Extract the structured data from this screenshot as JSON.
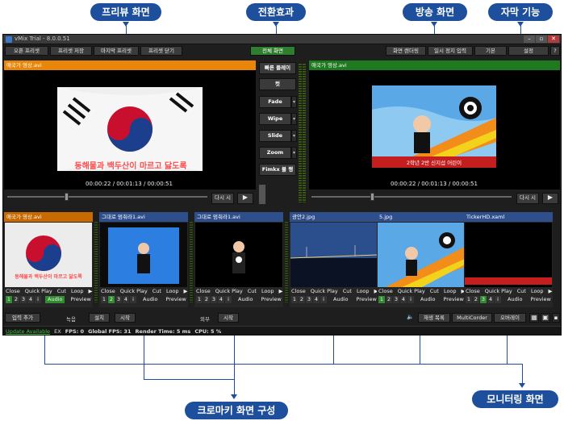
{
  "callouts": {
    "preview": "프리뷰 화면",
    "transition": "전환효과",
    "output": "방송 화면",
    "subtitle": "자막 기능",
    "chroma": "크로마키 화면 구성",
    "monitor": "모니터링 화면"
  },
  "window": {
    "title": "vMix Trial - 8.0.0.51",
    "min": "–",
    "max": "▫",
    "close": "✕"
  },
  "toolbar": {
    "open_preset": "오픈 프리셋",
    "save_preset": "프리셋 저장",
    "last_preset": "마지막 프리셋",
    "close_preset": "프리셋 닫기",
    "fullscreen": "전체 화면",
    "screen_render": "화면 렌더링",
    "pause_input": "일시 정지 입력",
    "basic": "기본",
    "settings": "설정",
    "help": "?"
  },
  "preview": {
    "header": "애국가 영상.avi",
    "timecode": "00:00:22 / 00:01:13 / 00:00:51",
    "restart": "다시 시"
  },
  "output": {
    "header": "애국가 영상.avi",
    "timecode": "00:00:22 / 00:01:13 / 00:00:51",
    "restart": "다시 시",
    "caption": "2학년 2반 신지섭 어린이"
  },
  "transitions": {
    "quick_play": "빠른 플레이",
    "cut": "컷",
    "fade": "Fade",
    "wipe": "Wipe",
    "slide": "Slide",
    "zoom": "Zoom",
    "ftb": "Fimkx 블 랭",
    "arrow": "▾"
  },
  "anthem_lyric": "동해물과 백두산이 마르고 닳도록",
  "inputs": [
    {
      "name": "애국가 영상.avi",
      "active": "true",
      "n_on": "1"
    },
    {
      "name": "그대로 멈춰라1.avi",
      "active": "false",
      "n_on": "2"
    },
    {
      "name": "그대로 멈춰라1.avi",
      "active": "false",
      "n_on": ""
    },
    {
      "name": "광안2.jpg",
      "active": "false",
      "n_on": ""
    },
    {
      "name": "5.jpg",
      "active": "false",
      "n_on": "1"
    },
    {
      "name": "TickerHD.xaml",
      "active": "false",
      "n_on": "3"
    }
  ],
  "input_controls": {
    "close": "Close",
    "quick_play": "Quick Play",
    "cut": "Cut",
    "loop": "Loop",
    "play": "▶",
    "n1": "1",
    "n2": "2",
    "n3": "3",
    "n4": "4",
    "i": "i",
    "audio": "Audio",
    "preview": "Preview"
  },
  "bottom_bar": {
    "add_input": "입력 추가",
    "record": "녹음",
    "settings": "설치",
    "start": "시작",
    "external": "외부",
    "external_start": "시작",
    "volume": "🔈",
    "playlist": "재생 목록",
    "multicorder": "MultiCorder",
    "overlay": "오버레이"
  },
  "status": {
    "update": "Update Available",
    "ex": "EX",
    "fps": "FPS: 0",
    "global_fps": "Global FPS: 31",
    "render": "Render Time: 5 ms",
    "cpu": "CPU: 5 %"
  }
}
